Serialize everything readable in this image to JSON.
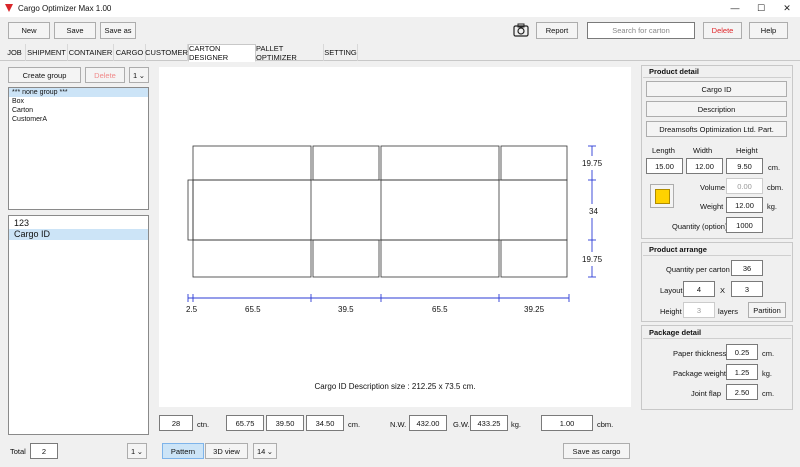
{
  "window": {
    "title": "Cargo Optimizer Max 1.00",
    "minimize": "—",
    "maximize": "☐",
    "close": "✕"
  },
  "toolbar": {
    "new": "New",
    "save": "Save",
    "save_as": "Save as",
    "report": "Report",
    "search_placeholder": "Search for carton",
    "delete": "Delete",
    "help": "Help"
  },
  "tabs": [
    "JOB",
    "SHIPMENT",
    "CONTAINER",
    "CARGO",
    "CUSTOMER",
    "CARTON DESIGNER",
    "PALLET OPTIMIZER",
    "SETTING"
  ],
  "active_tab": "CARTON DESIGNER",
  "left": {
    "create_group": "Create group",
    "delete": "Delete",
    "group_select": "1",
    "groups": [
      "*** none group ***",
      "Box",
      "Carton",
      "CustomerA"
    ],
    "items": [
      "123",
      "Cargo ID"
    ],
    "total_label": "Total",
    "total_value": "2",
    "page_select": "1"
  },
  "canvas": {
    "caption": "Cargo ID Description size : 212.25 x 73.5 cm.",
    "right_dims": [
      "19.75",
      "34",
      "19.75"
    ],
    "bottom_dims": [
      "2.5",
      "65.5",
      "39.5",
      "65.5",
      "39.25"
    ]
  },
  "bottom_bar": {
    "ctn_value": "28",
    "ctn_unit": "ctn.",
    "dim1": "65.75",
    "dim2": "39.50",
    "dim3": "34.50",
    "dim_unit": "cm.",
    "nw_label": "N.W.",
    "nw_value": "432.00",
    "gw_label": "G.W.",
    "gw_value": "433.25",
    "weight_unit": "kg.",
    "cbm_value": "1.00",
    "cbm_unit": "cbm.",
    "pattern": "Pattern",
    "view3d": "3D view",
    "count_select": "14",
    "save_as_cargo": "Save as cargo"
  },
  "product_detail": {
    "header": "Product detail",
    "cargo_id": "Cargo ID",
    "description": "Description",
    "company": "Dreamsofts Optimization Ltd. Part.",
    "length_label": "Length",
    "width_label": "Width",
    "height_label": "Height",
    "length": "15.00",
    "width": "12.00",
    "height": "9.50",
    "dim_unit": "cm.",
    "volume_label": "Volume",
    "volume": "0.00",
    "volume_unit": "cbm.",
    "weight_label": "Weight",
    "weight": "12.00",
    "weight_unit": "kg.",
    "qty_label": "Quantity (option)",
    "qty": "1000",
    "color": "#ffd200"
  },
  "product_arrange": {
    "header": "Product arrange",
    "qpc_label": "Quantity per carton",
    "qpc": "36",
    "layout_label": "Layout",
    "layout_x": "4",
    "x_label": "X",
    "layout_y": "3",
    "height_label": "Height",
    "height": "3",
    "layers_label": "layers",
    "partition": "Partition"
  },
  "package_detail": {
    "header": "Package detail",
    "thickness_label": "Paper thickness",
    "thickness": "0.25",
    "thickness_unit": "cm.",
    "pw_label": "Package weight",
    "pw": "1.25",
    "pw_unit": "kg.",
    "jf_label": "Joint flap",
    "jf": "2.50",
    "jf_unit": "cm."
  }
}
